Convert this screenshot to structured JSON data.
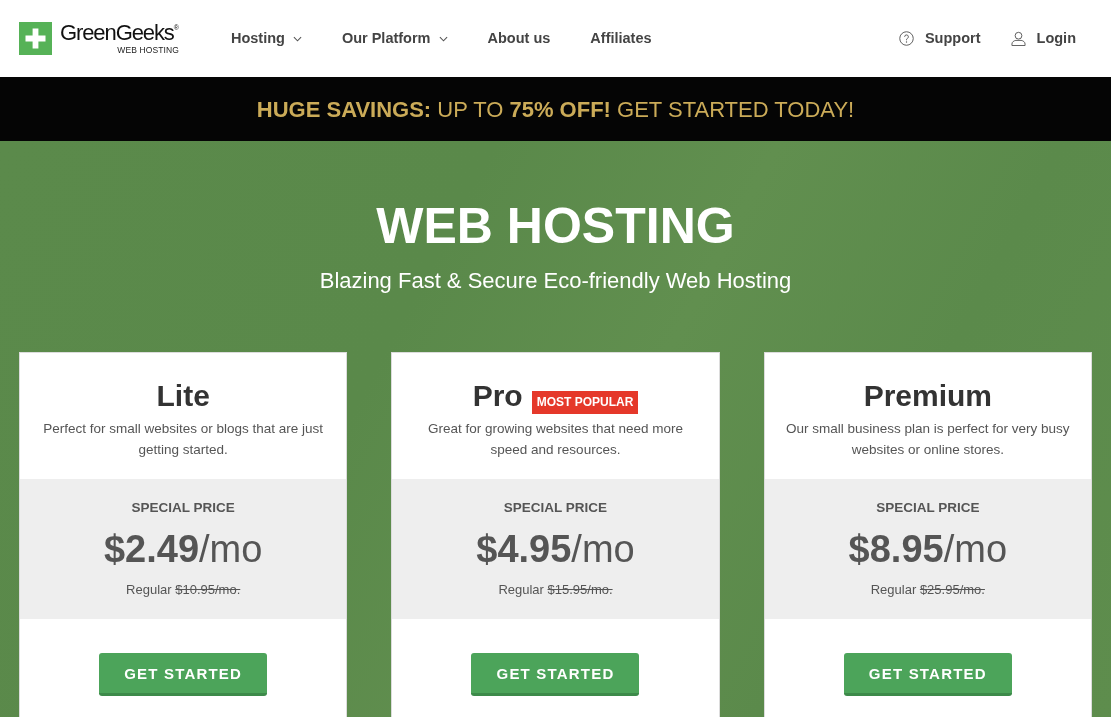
{
  "header": {
    "logo": {
      "name": "GreenGeeks$^{®}$",
      "tagline": "WEB HOSTING"
    },
    "nav": [
      {
        "label": "Hosting",
        "dropdown": true
      },
      {
        "label": "Our Platform",
        "dropdown": true
      },
      {
        "label": "About us",
        "dropdown": false
      },
      {
        "label": "Affiliates",
        "dropdown": false
      }
    ],
    "utility_links": [
      {
        "label": "Support",
        "kind": "support"
      },
      {
        "label": "Login",
        "kind": "login"
      }
    ]
  },
  "promo_banner": {
    "text": "**HUGE SAVINGS:** UP TO **75% OFF!** GET STARTED TODAY!"
  },
  "hero": {
    "title": "WEB HOSTING",
    "subtitle": "Blazing Fast & Secure Eco-friendly Web Hosting"
  },
  "plans": [
    {
      "name": "Lite",
      "description": "Perfect for small websites or blogs that are just getting started.",
      "price_label": "SPECIAL PRICE",
      "price": "**$2.49**/mo",
      "regular_label": "Regular",
      "regular_price": "$10.95/mo.",
      "button": "GET STARTED"
    },
    {
      "name": "Pro",
      "badge": "MOST POPULAR",
      "description": "Great for growing websites that need more speed and resources.",
      "price_label": "SPECIAL PRICE",
      "price": "**$4.95**/mo",
      "regular_label": "Regular",
      "regular_price": "$15.95/mo.",
      "button": "GET STARTED"
    },
    {
      "name": "Premium",
      "description": "Our small business plan is perfect for very busy websites or online stores.",
      "price_label": "SPECIAL PRICE",
      "price": "**$8.95**/mo",
      "regular_label": "Regular",
      "regular_price": "$25.95/mo.",
      "button": "GET STARTED"
    }
  ]
}
